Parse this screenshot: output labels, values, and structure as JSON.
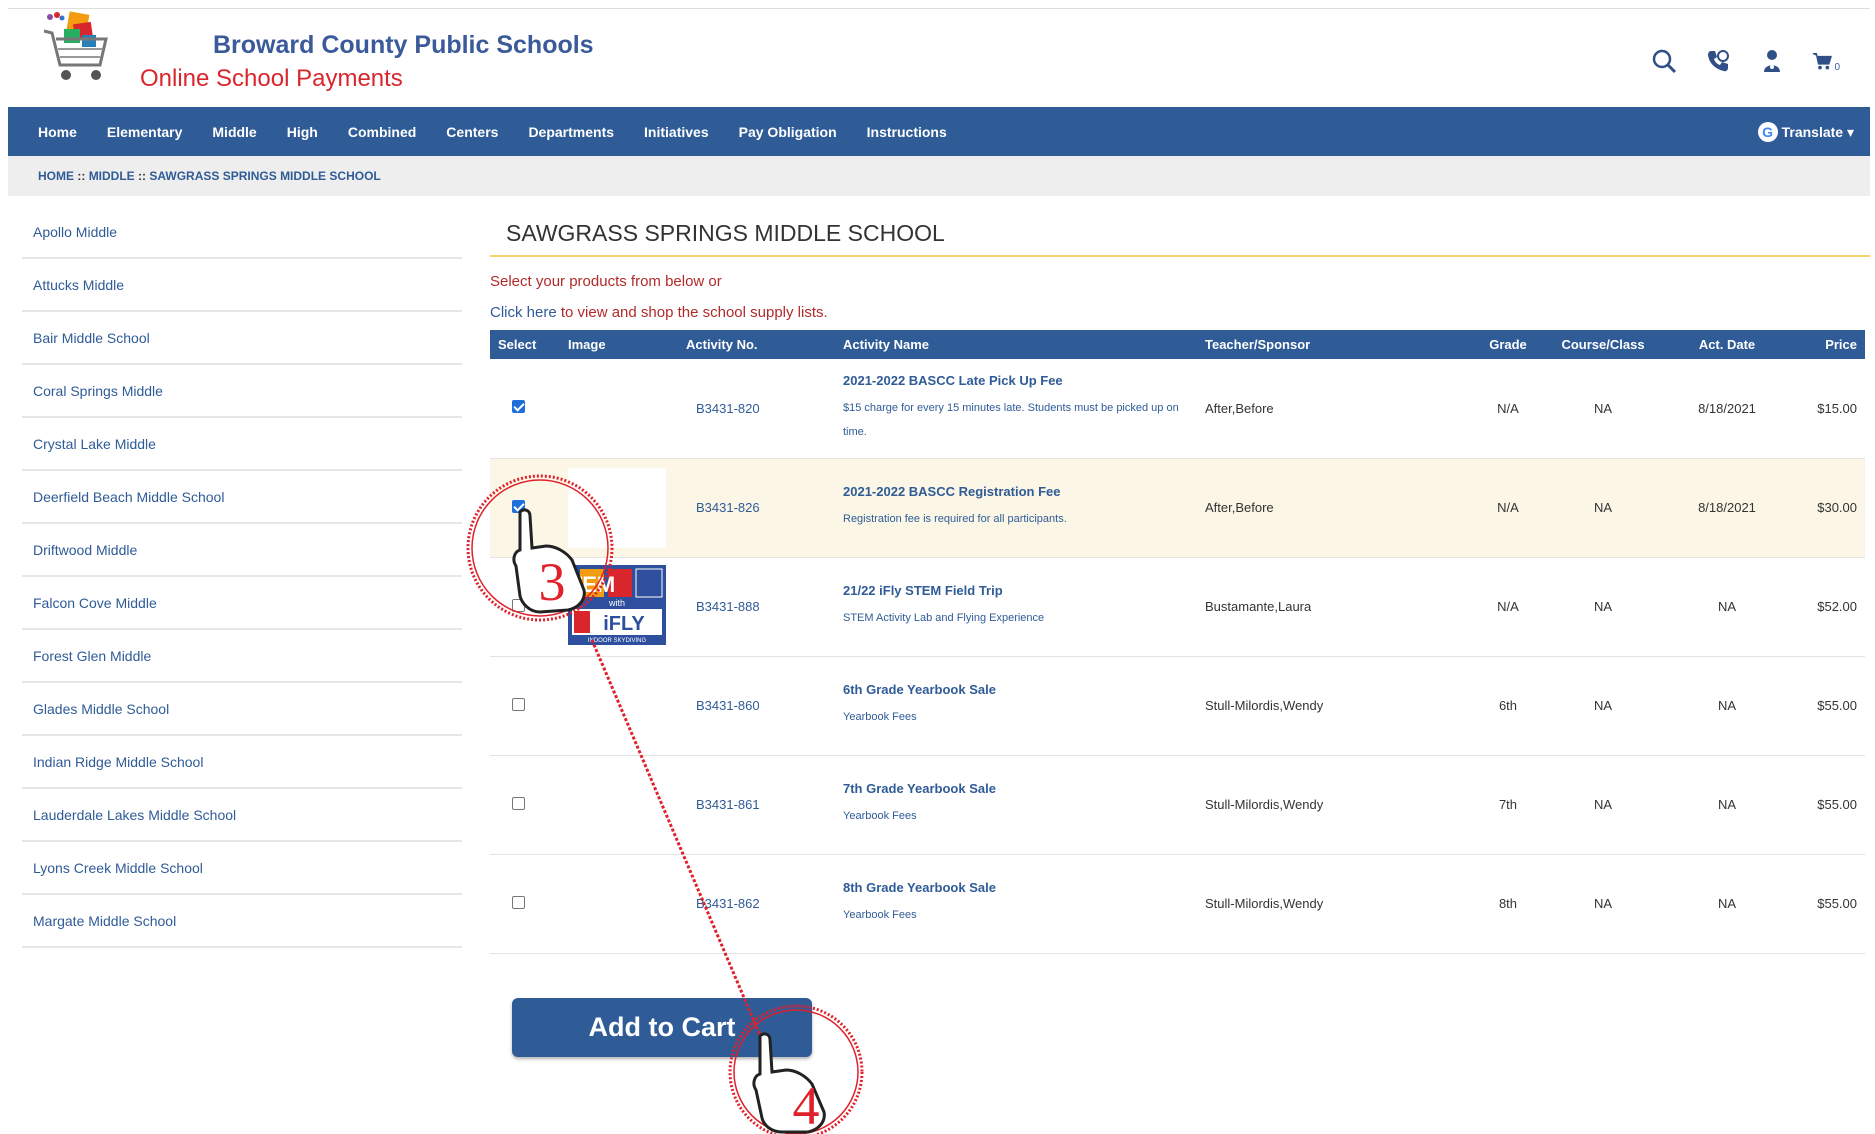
{
  "header": {
    "title": "Broward County Public Schools",
    "subtitle": "Online School Payments",
    "cart_count": "0",
    "icons": [
      "search-icon",
      "phone-icon",
      "user-icon",
      "cart-icon"
    ]
  },
  "nav": {
    "items": [
      "Home",
      "Elementary",
      "Middle",
      "High",
      "Combined",
      "Centers",
      "Departments",
      "Initiatives",
      "Pay Obligation",
      "Instructions"
    ],
    "translate": "Translate ▾"
  },
  "breadcrumb": {
    "home": "HOME",
    "sep": "::",
    "middle": "MIDDLE",
    "school": "SAWGRASS SPRINGS MIDDLE SCHOOL"
  },
  "sidebar": {
    "items": [
      "Apollo Middle",
      "Attucks Middle",
      "Bair Middle School",
      "Coral Springs Middle",
      "Crystal Lake Middle",
      "Deerfield Beach Middle School",
      "Driftwood Middle",
      "Falcon Cove Middle",
      "Forest Glen Middle",
      "Glades Middle School",
      "Indian Ridge Middle School",
      "Lauderdale Lakes Middle School",
      "Lyons Creek Middle School",
      "Margate Middle School"
    ]
  },
  "main": {
    "title": "SAWGRASS SPRINGS MIDDLE SCHOOL",
    "intro1": "Select your products from below or",
    "intro2_link": "Click here",
    "intro2_rest": " to view and shop the school supply lists."
  },
  "table": {
    "headers": [
      "Select",
      "Image",
      "Activity No.",
      "Activity Name",
      "Teacher/Sponsor",
      "Grade",
      "Course/Class",
      "Act. Date",
      "Price"
    ],
    "rows": [
      {
        "checked": true,
        "image": "",
        "no": "B3431-820",
        "name": "2021-2022 BASCC Late Pick Up Fee",
        "desc": "$15 charge for every 15 minutes late. Students must be picked up on time.",
        "teacher": "After,Before",
        "grade": "N/A",
        "course": "NA",
        "date": "8/18/2021",
        "price": "$15.00"
      },
      {
        "checked": true,
        "image": "white",
        "no": "B3431-826",
        "name": "2021-2022 BASCC Registration Fee",
        "desc": "Registration fee is required for all participants.",
        "teacher": "After,Before",
        "grade": "N/A",
        "course": "NA",
        "date": "8/18/2021",
        "price": "$30.00"
      },
      {
        "checked": false,
        "image": "stem",
        "no": "B3431-888",
        "name": "21/22 iFly STEM Field Trip",
        "desc": "STEM Activity Lab and Flying Experience",
        "teacher": "Bustamante,Laura",
        "grade": "N/A",
        "course": "NA",
        "date": "NA",
        "price": "$52.00"
      },
      {
        "checked": false,
        "image": "",
        "no": "B3431-860",
        "name": "6th Grade Yearbook Sale",
        "desc": "Yearbook Fees",
        "teacher": "Stull-Milordis,Wendy",
        "grade": "6th",
        "course": "NA",
        "date": "NA",
        "price": "$55.00"
      },
      {
        "checked": false,
        "image": "",
        "no": "B3431-861",
        "name": "7th Grade Yearbook Sale",
        "desc": "Yearbook Fees",
        "teacher": "Stull-Milordis,Wendy",
        "grade": "7th",
        "course": "NA",
        "date": "NA",
        "price": "$55.00"
      },
      {
        "checked": false,
        "image": "",
        "no": "B3431-862",
        "name": "8th Grade Yearbook Sale",
        "desc": "Yearbook Fees",
        "teacher": "Stull-Milordis,Wendy",
        "grade": "8th",
        "course": "NA",
        "date": "NA",
        "price": "$55.00"
      }
    ],
    "stem_logo": {
      "letters": "TEM",
      "with": "with",
      "brand": "iFLY",
      "tagline": "INDOOR SKYDIVING"
    }
  },
  "add_to_cart": "Add to Cart",
  "annotations": {
    "step3": "3",
    "step4": "4"
  },
  "colors": {
    "nav": "#2f5b97",
    "accent_red": "#d8262c",
    "annot_red": "#e0202a",
    "title_rule": "#f4d56b"
  }
}
